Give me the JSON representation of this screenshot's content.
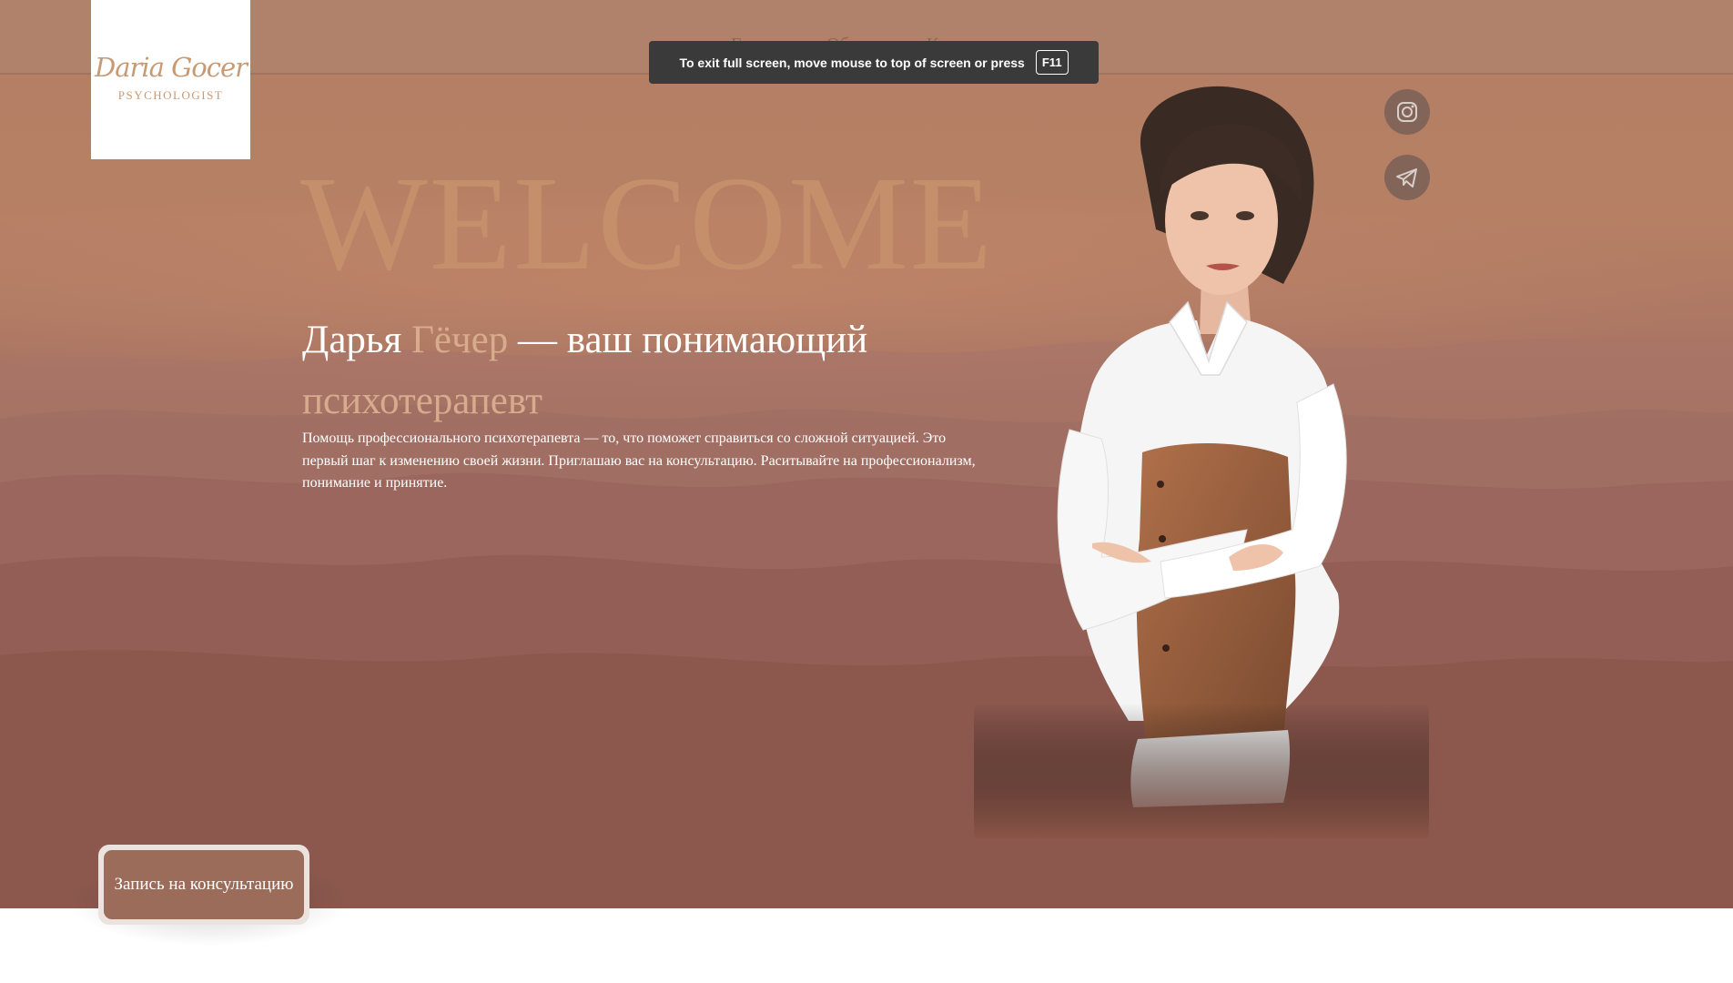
{
  "colors": {
    "accent": "#c58f6b",
    "brand_brown": "#9c6c5a",
    "topbar": "#b1826b"
  },
  "logo": {
    "script": "Daria Gocer",
    "subtitle": "PSYCHOLOGIST"
  },
  "nav": {
    "items": [
      "Главная",
      "Обо мне",
      "Контакты"
    ]
  },
  "fullscreen_notice": {
    "text": "To exit full screen, move mouse to top of screen or press",
    "key": "F11"
  },
  "hero": {
    "welcome": "WELCOME",
    "headline_part1": "Дарья ",
    "headline_accent1": "Гёчер",
    "headline_part2": " — ваш понимающий ",
    "headline_accent2": "психотерапевт",
    "description": "Помощь профессионального психотерапевта — то, что поможет справиться со сложной ситуацией. Это первый шаг к изменению своей жизни. Приглашаю вас на консультацию. Раситывайте на профессионализм, понимание и принятие."
  },
  "social": {
    "icons": [
      "instagram-icon",
      "telegram-icon"
    ]
  },
  "cta": {
    "label": "Запись на консультацию"
  }
}
